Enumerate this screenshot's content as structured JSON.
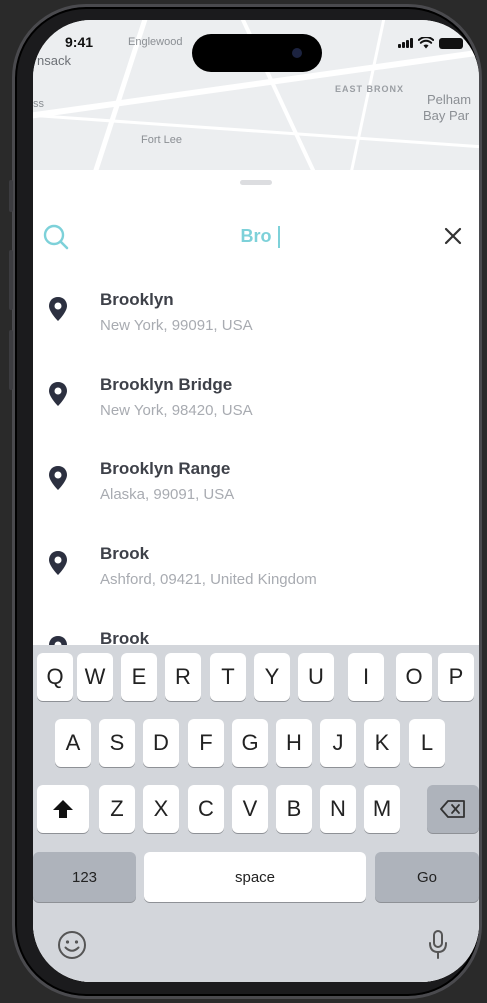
{
  "status": {
    "time": "9:41"
  },
  "map": {
    "labels": [
      "Englewood",
      "nsack",
      "EAST BRONX",
      "Pelham",
      "Bay Par",
      "Fort Lee",
      "ss"
    ]
  },
  "search": {
    "value": "Bro",
    "accent": "#7dd1d9"
  },
  "results": [
    {
      "title": "Brooklyn",
      "subtitle": "New York, 99091, USA"
    },
    {
      "title": "Brooklyn Bridge",
      "subtitle": "New York, 98420, USA"
    },
    {
      "title": "Brooklyn Range",
      "subtitle": "Alaska, 99091, USA"
    },
    {
      "title": "Brook",
      "subtitle": "Ashford, 09421, United Kingdom"
    },
    {
      "title": "Brook",
      "subtitle": ""
    }
  ],
  "keyboard": {
    "row1": [
      "Q",
      "W",
      "E",
      "R",
      "T",
      "Y",
      "U",
      "I",
      "O",
      "P"
    ],
    "row2": [
      "A",
      "S",
      "D",
      "F",
      "G",
      "H",
      "J",
      "K",
      "L"
    ],
    "row3": [
      "Z",
      "X",
      "C",
      "V",
      "B",
      "N",
      "M"
    ],
    "numbers_label": "123",
    "space_label": "space",
    "go_label": "Go"
  },
  "icons": {
    "search": "search-icon",
    "close": "close-icon",
    "pin": "location-pin-icon",
    "shift": "shift-icon",
    "backspace": "backspace-icon",
    "emoji": "emoji-icon",
    "mic": "microphone-icon"
  }
}
